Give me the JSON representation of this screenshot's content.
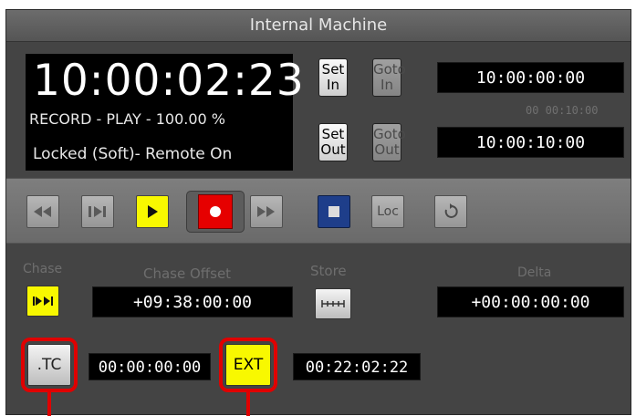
{
  "window": {
    "title": "Internal Machine"
  },
  "display": {
    "timecode": "10:00:02:23",
    "status": "RECORD - PLAY - 100.00 %",
    "lock": "Locked (Soft)- Remote On"
  },
  "marks": {
    "set_in_line1": "Set",
    "set_in_line2": "In",
    "goto_in_line1": "Goto",
    "goto_in_line2": "In",
    "set_out_line1": "Set",
    "set_out_line2": "Out",
    "goto_out_line1": "Goto",
    "goto_out_line2": "Out",
    "in_time": "10:00:00:00",
    "duration": "00 00:10:00",
    "out_time": "10:00:10:00"
  },
  "transport": {
    "rewind_icon": "rewind-icon",
    "step_icon": "step-forward-icon",
    "play_icon": "play-icon",
    "record_icon": "record-icon",
    "ffwd_icon": "fast-forward-icon",
    "stop_icon": "stop-icon",
    "loc_label": "Loc",
    "loop_icon": "loop-icon",
    "play_color": "#f8f800",
    "record_color": "#e60000",
    "stop_color": "#1e3e8a"
  },
  "chase": {
    "chase_label": "Chase",
    "chase_offset_label": "Chase Offset",
    "chase_offset_value": "+09:38:00:00",
    "store_label": "Store",
    "delta_label": "Delta",
    "delta_value": "+00:00:00:00"
  },
  "sources": {
    "tc_button_label": ".TC",
    "tc_value": "00:00:00:00",
    "ext_button_label": "EXT",
    "ext_value": "00:22:02:22",
    "highlight_color": "#e00000"
  }
}
